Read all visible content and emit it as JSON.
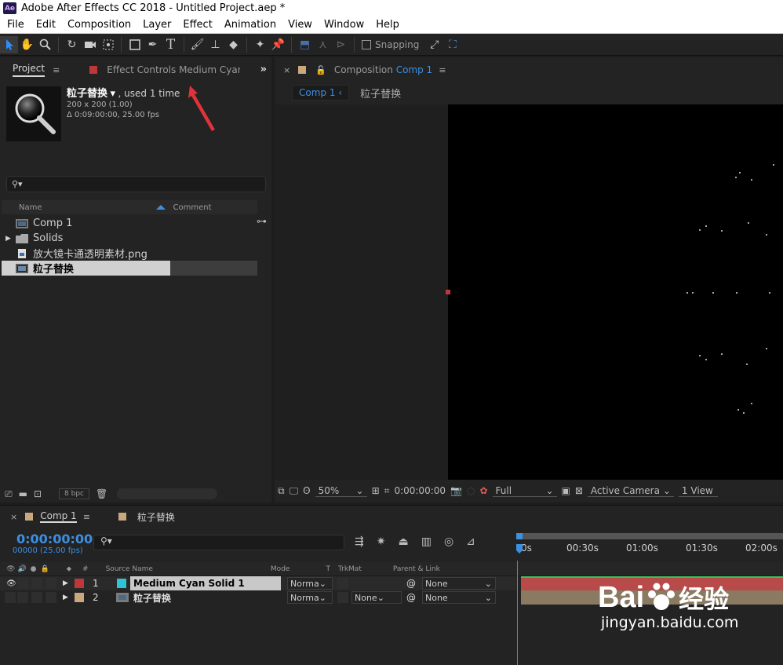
{
  "window": {
    "title": "Adobe After Effects CC 2018 - Untitled Project.aep *",
    "app_badge": "Ae"
  },
  "menu": [
    "File",
    "Edit",
    "Composition",
    "Layer",
    "Effect",
    "Animation",
    "View",
    "Window",
    "Help"
  ],
  "toolbar": {
    "snapping_label": "Snapping"
  },
  "project": {
    "tab_label": "Project",
    "effect_tab_label": "Effect Controls  Medium Cyan Sc",
    "selected_name": "粒子替换",
    "used_text": ", used 1 time",
    "dimensions": "200 x 200 (1.00)",
    "duration": "Δ 0:09:00:00, 25.00 fps",
    "col_name": "Name",
    "col_comment": "Comment",
    "items": [
      {
        "name": "Comp 1",
        "type": "comp"
      },
      {
        "name": "Solids",
        "type": "folder"
      },
      {
        "name": "放大镜卡通透明素材.png",
        "type": "image"
      },
      {
        "name": "粒子替换",
        "type": "comp"
      }
    ],
    "bpc": "8 bpc"
  },
  "composition": {
    "tab_prefix": "Composition",
    "tab_comp": "Comp 1",
    "crumb_active": "Comp 1",
    "crumb_next": "粒子替换",
    "zoom": "50%",
    "timecode": "0:00:00:00",
    "resolution": "Full",
    "camera": "Active Camera",
    "views": "1 View"
  },
  "timeline": {
    "tabs": [
      "Comp 1",
      "粒子替换"
    ],
    "timecode": "0:00:00:00",
    "fps": "00000 (25.00 fps)",
    "ruler": [
      "0s",
      "00:30s",
      "01:00s",
      "01:30s",
      "02:00s"
    ],
    "headers": {
      "num": "#",
      "source": "Source Name",
      "mode": "Mode",
      "t": "T",
      "trkmat": "TrkMat",
      "parent": "Parent & Link"
    },
    "layers": [
      {
        "num": "1",
        "name": "Medium Cyan Solid 1",
        "mode": "Norma",
        "trkmat": "",
        "parent": "None",
        "label_color": "#c0373a"
      },
      {
        "num": "2",
        "name": "粒子替换",
        "mode": "Norma",
        "trkmat": "None",
        "parent": "None",
        "label_color": "#c8a87c"
      }
    ]
  },
  "watermark": {
    "brand": "Bai",
    "brand_cn": "经验",
    "url": "jingyan.baidu.com"
  },
  "colors": {
    "accent": "#3d8fe0",
    "solid_red": "#c0373a",
    "comp_tan": "#c8a87c",
    "track_red": "#b84a4a",
    "arrow": "#e0323a"
  }
}
